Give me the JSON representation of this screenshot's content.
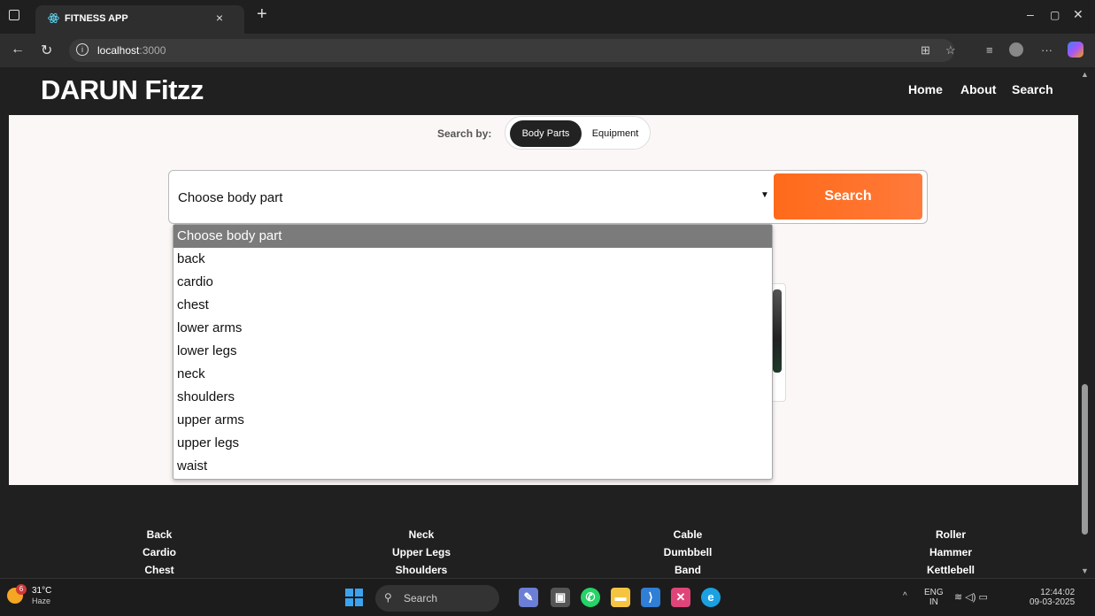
{
  "browser": {
    "tab_title": "FITNESS APP",
    "tab_close": "×",
    "new_tab": "+",
    "url_host": "localhost",
    "url_port": ":3000",
    "win_min": "–",
    "win_max": "▢",
    "win_close": "✕"
  },
  "site": {
    "logo": "DARUN Fitzz",
    "nav": [
      "Home",
      "About",
      "Search"
    ]
  },
  "search": {
    "label": "Search by:",
    "toggle": [
      "Body Parts",
      "Equipment"
    ],
    "selected_value": "Choose body part",
    "button": "Search"
  },
  "dropdown": {
    "options": [
      "Choose body part",
      "back",
      "cardio",
      "chest",
      "lower arms",
      "lower legs",
      "neck",
      "shoulders",
      "upper arms",
      "upper legs",
      "waist"
    ]
  },
  "footer": {
    "columns": [
      [
        "Back",
        "Cardio",
        "Chest"
      ],
      [
        "Neck",
        "Upper Legs",
        "Shoulders"
      ],
      [
        "Cable",
        "Dumbbell",
        "Band"
      ],
      [
        "Roller",
        "Hammer",
        "Kettlebell"
      ]
    ]
  },
  "taskbar": {
    "temp": "31°C",
    "condition": "Haze",
    "badge": "6",
    "search_label": "Search",
    "lang": "ENG",
    "region": "IN",
    "time": "12:44:02",
    "date": "09-03-2025"
  },
  "colors": {
    "accent": "#ff6a1a",
    "header_bg": "#202020",
    "page_bg": "#fbf7f6"
  }
}
